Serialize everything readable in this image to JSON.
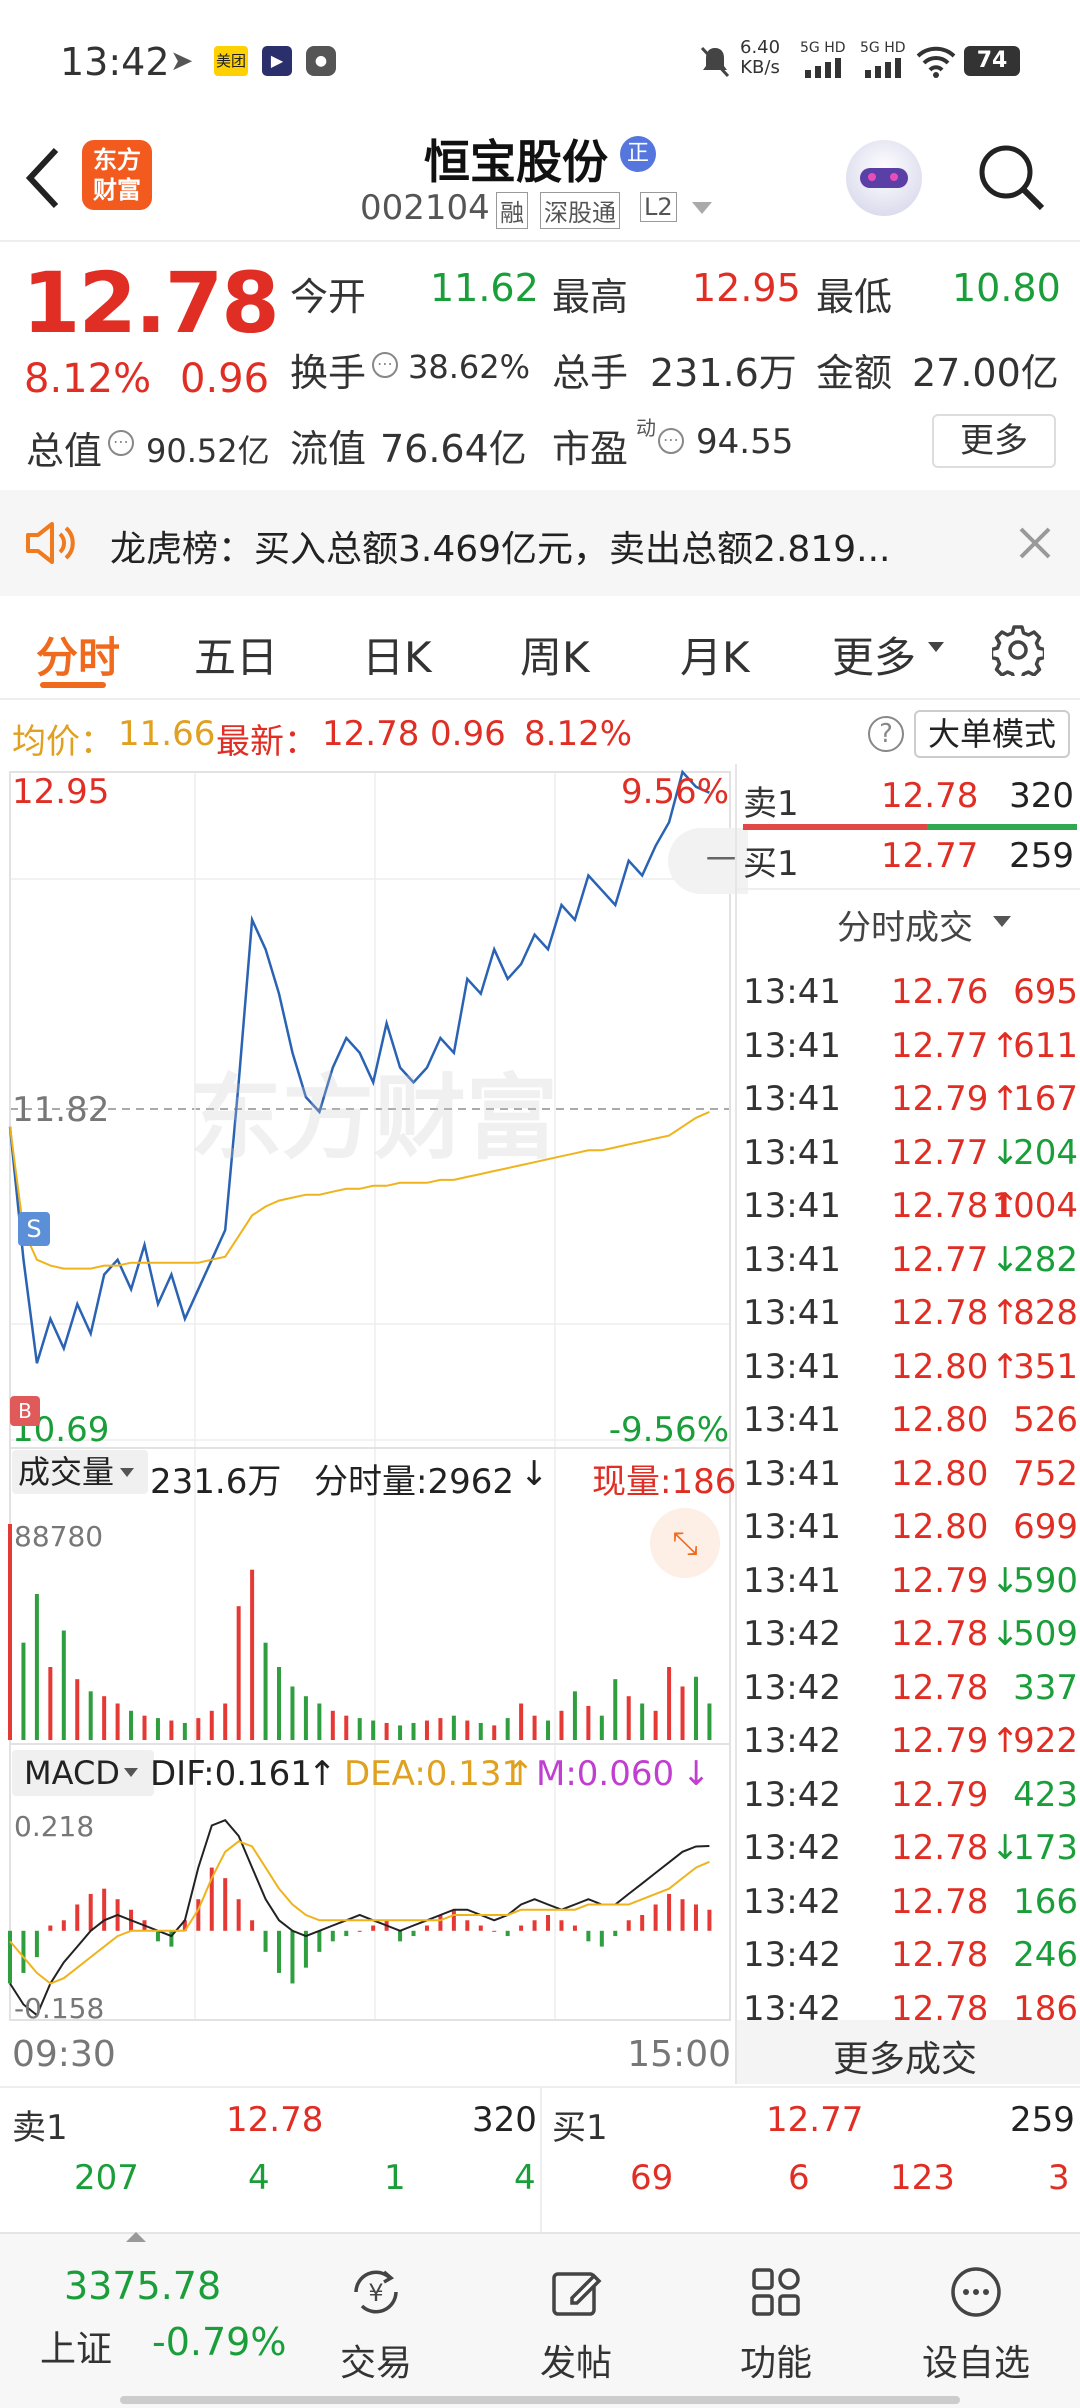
{
  "status_bar": {
    "time": "13:42",
    "app_badge": "美团",
    "speed": "6.40",
    "speed_unit": "KB/s",
    "net1": "5G HD",
    "net2": "5G HD",
    "battery": "74"
  },
  "header": {
    "logo_line1": "东方",
    "logo_line2": "财富",
    "stock_name": "恒宝股份",
    "badge": "正",
    "code": "002104",
    "tag1": "融",
    "tag2": "深股通",
    "tag3": "L2"
  },
  "quote": {
    "price": "12.78",
    "change_pct": "8.12%",
    "change": "0.96",
    "open_label": "今开",
    "open": "11.62",
    "high_label": "最高",
    "high": "12.95",
    "low_label": "最低",
    "low": "10.80",
    "turnover_label": "换手",
    "turnover": "38.62%",
    "volume_label": "总手",
    "volume": "231.6万",
    "amount_label": "金额",
    "amount": "27.00亿",
    "mcap_label": "总值",
    "mcap": "90.52亿",
    "float_label": "流值",
    "float_cap": "76.64亿",
    "pe_label": "市盈",
    "pe_sup": "动",
    "pe": "94.55",
    "more": "更多"
  },
  "notice": {
    "text": "龙虎榜：买入总额3.469亿元，卖出总额2.819..."
  },
  "tabs": [
    "分时",
    "五日",
    "日K",
    "周K",
    "月K",
    "更多"
  ],
  "infobar": {
    "avg_label": "均价：",
    "avg": "11.66",
    "latest_label": "最新：",
    "latest": "12.78",
    "chg": "0.96",
    "pct": "8.12%",
    "mode_btn": "大单模式"
  },
  "chart": {
    "top_price": "12.95",
    "top_pct": "9.56%",
    "mid_price": "11.82",
    "bot_price": "10.69",
    "bot_pct": "-9.56%",
    "watermark": "东方财富",
    "marker_s": "S",
    "marker_b": "B",
    "vol_label": "成交量",
    "vol_total": "231.6万",
    "vol_fs": "分时量:2962",
    "vol_now": "现量:186",
    "vol_max": "88780",
    "macd_label": "MACD",
    "dif": "DIF:0.161",
    "dea": "DEA:0.131",
    "m": "M:0.060",
    "macd_top": "0.218",
    "macd_bot": "-0.158",
    "time_start": "09:30",
    "time_end": "15:00"
  },
  "chart_data": {
    "type": "line",
    "ylim": [
      10.69,
      12.95
    ],
    "price": [
      11.75,
      11.3,
      10.95,
      11.1,
      11.0,
      11.15,
      11.05,
      11.25,
      11.3,
      11.2,
      11.35,
      11.15,
      11.25,
      11.1,
      11.2,
      11.3,
      11.4,
      11.9,
      12.45,
      12.35,
      12.2,
      12.0,
      11.85,
      11.8,
      11.95,
      12.05,
      12.0,
      11.9,
      12.1,
      11.95,
      11.9,
      11.95,
      12.05,
      12.0,
      12.25,
      12.2,
      12.35,
      12.25,
      12.3,
      12.4,
      12.35,
      12.5,
      12.45,
      12.6,
      12.55,
      12.5,
      12.65,
      12.6,
      12.7,
      12.78,
      12.95,
      12.9,
      12.88
    ],
    "avg": [
      11.75,
      11.4,
      11.3,
      11.28,
      11.27,
      11.27,
      11.27,
      11.28,
      11.28,
      11.29,
      11.29,
      11.29,
      11.29,
      11.29,
      11.29,
      11.3,
      11.31,
      11.38,
      11.45,
      11.48,
      11.5,
      11.51,
      11.52,
      11.52,
      11.53,
      11.54,
      11.54,
      11.55,
      11.55,
      11.56,
      11.56,
      11.56,
      11.57,
      11.57,
      11.58,
      11.59,
      11.6,
      11.61,
      11.62,
      11.63,
      11.64,
      11.65,
      11.66,
      11.67,
      11.67,
      11.68,
      11.69,
      11.7,
      11.71,
      11.72,
      11.75,
      11.78,
      11.8
    ],
    "volume_max": 88780,
    "volume": [
      88780,
      40000,
      60000,
      30000,
      45000,
      25000,
      20000,
      18000,
      15000,
      12000,
      10000,
      9000,
      8000,
      7000,
      9000,
      12000,
      15000,
      55000,
      70000,
      40000,
      30000,
      22000,
      18000,
      15000,
      12000,
      10000,
      9000,
      8000,
      7000,
      6000,
      7000,
      8000,
      9000,
      10000,
      8000,
      7000,
      6000,
      9000,
      15000,
      10000,
      8000,
      12000,
      20000,
      14000,
      10000,
      25000,
      18000,
      15000,
      12000,
      30000,
      22000,
      26000,
      15000
    ],
    "macd_ylim": [
      -0.158,
      0.218
    ],
    "macd_hist": [
      -0.1,
      -0.08,
      -0.05,
      0.01,
      0.02,
      0.05,
      0.07,
      0.08,
      0.06,
      0.04,
      0.02,
      -0.02,
      -0.03,
      0.02,
      0.06,
      0.12,
      0.1,
      0.06,
      0.02,
      -0.04,
      -0.08,
      -0.1,
      -0.07,
      -0.04,
      -0.02,
      -0.01,
      0.0,
      0.01,
      0.02,
      -0.02,
      -0.01,
      0.01,
      0.03,
      0.04,
      0.02,
      0.01,
      0.0,
      -0.01,
      0.01,
      0.02,
      0.03,
      0.02,
      0.01,
      -0.02,
      -0.03,
      -0.01,
      0.02,
      0.03,
      0.05,
      0.07,
      0.06,
      0.05,
      0.04
    ],
    "dif": [
      -0.1,
      -0.14,
      -0.16,
      -0.1,
      -0.06,
      -0.03,
      0.0,
      0.02,
      0.03,
      0.02,
      0.01,
      0.0,
      -0.01,
      0.02,
      0.12,
      0.2,
      0.21,
      0.18,
      0.12,
      0.06,
      0.02,
      0.0,
      -0.01,
      0.0,
      0.01,
      0.02,
      0.03,
      0.02,
      0.01,
      0.0,
      0.01,
      0.02,
      0.03,
      0.04,
      0.04,
      0.03,
      0.02,
      0.03,
      0.05,
      0.06,
      0.05,
      0.04,
      0.05,
      0.06,
      0.05,
      0.05,
      0.07,
      0.09,
      0.11,
      0.13,
      0.15,
      0.16,
      0.161
    ],
    "dea": [
      -0.02,
      -0.05,
      -0.08,
      -0.1,
      -0.09,
      -0.07,
      -0.05,
      -0.03,
      -0.01,
      0.0,
      0.0,
      0.0,
      0.0,
      0.0,
      0.04,
      0.1,
      0.15,
      0.17,
      0.16,
      0.12,
      0.08,
      0.05,
      0.03,
      0.02,
      0.02,
      0.02,
      0.02,
      0.02,
      0.02,
      0.02,
      0.02,
      0.02,
      0.02,
      0.03,
      0.03,
      0.03,
      0.03,
      0.03,
      0.04,
      0.04,
      0.04,
      0.04,
      0.04,
      0.05,
      0.05,
      0.05,
      0.05,
      0.06,
      0.07,
      0.08,
      0.1,
      0.12,
      0.131
    ]
  },
  "orderbook": {
    "sell1_label": "卖1",
    "sell1_price": "12.78",
    "sell1_vol": "320",
    "buy1_label": "买1",
    "buy1_price": "12.77",
    "buy1_vol": "259",
    "ticks_title": "分时成交",
    "more_trades": "更多成交",
    "ticks": [
      {
        "time": "13:41",
        "price": "12.76",
        "arrow": "",
        "vol": "695",
        "dir": "r"
      },
      {
        "time": "13:41",
        "price": "12.77",
        "arrow": "↑",
        "vol": "611",
        "dir": "r"
      },
      {
        "time": "13:41",
        "price": "12.79",
        "arrow": "↑",
        "vol": "167",
        "dir": "r"
      },
      {
        "time": "13:41",
        "price": "12.77",
        "arrow": "↓",
        "vol": "204",
        "dir": "g"
      },
      {
        "time": "13:41",
        "price": "12.78",
        "arrow": "↑",
        "vol": "1004",
        "dir": "r"
      },
      {
        "time": "13:41",
        "price": "12.77",
        "arrow": "↓",
        "vol": "282",
        "dir": "g"
      },
      {
        "time": "13:41",
        "price": "12.78",
        "arrow": "↑",
        "vol": "828",
        "dir": "r"
      },
      {
        "time": "13:41",
        "price": "12.80",
        "arrow": "↑",
        "vol": "351",
        "dir": "r"
      },
      {
        "time": "13:41",
        "price": "12.80",
        "arrow": "",
        "vol": "526",
        "dir": "r"
      },
      {
        "time": "13:41",
        "price": "12.80",
        "arrow": "",
        "vol": "752",
        "dir": "r"
      },
      {
        "time": "13:41",
        "price": "12.80",
        "arrow": "",
        "vol": "699",
        "dir": "r"
      },
      {
        "time": "13:41",
        "price": "12.79",
        "arrow": "↓",
        "vol": "590",
        "dir": "g"
      },
      {
        "time": "13:42",
        "price": "12.78",
        "arrow": "↓",
        "vol": "509",
        "dir": "g"
      },
      {
        "time": "13:42",
        "price": "12.78",
        "arrow": "",
        "vol": "337",
        "dir": "g"
      },
      {
        "time": "13:42",
        "price": "12.79",
        "arrow": "↑",
        "vol": "922",
        "dir": "r"
      },
      {
        "time": "13:42",
        "price": "12.79",
        "arrow": "",
        "vol": "423",
        "dir": "g"
      },
      {
        "time": "13:42",
        "price": "12.78",
        "arrow": "↓",
        "vol": "173",
        "dir": "g"
      },
      {
        "time": "13:42",
        "price": "12.78",
        "arrow": "",
        "vol": "166",
        "dir": "g"
      },
      {
        "time": "13:42",
        "price": "12.78",
        "arrow": "",
        "vol": "246",
        "dir": "g"
      },
      {
        "time": "13:42",
        "price": "12.78",
        "arrow": "",
        "vol": "186",
        "dir": "r"
      }
    ]
  },
  "depth": {
    "sell_label": "卖1",
    "sell_price": "12.78",
    "sell_vol": "320",
    "buy_label": "买1",
    "buy_price": "12.77",
    "buy_vol": "259",
    "sell_cells": [
      "207",
      "4",
      "1",
      "4"
    ],
    "buy_cells": [
      "69",
      "6",
      "123",
      "3"
    ]
  },
  "bottom_nav": {
    "index_value": "3375.78",
    "index_name": "上证",
    "index_chg": "-0.79%",
    "items": [
      "交易",
      "发帖",
      "功能",
      "设自选"
    ]
  }
}
